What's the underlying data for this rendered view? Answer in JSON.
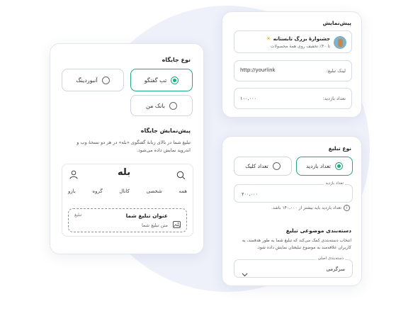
{
  "left": {
    "placement_title": "نوع جایگاه",
    "options": [
      "تب گفتگو",
      "آنبوردینگ",
      "بانک من"
    ],
    "preview_title": "پیش‌نمایش جایگاه",
    "preview_desc_1": "تبلیغ شما در بالای زبانهٔ گفتگوی «بله» در هر دو نسخهٔ وب و",
    "preview_desc_2": "اندروید نمایش داده می‌شود.",
    "app_logo": "بله",
    "tabs": [
      "همه",
      "شخصی",
      "کانال",
      "گروه",
      "بازو"
    ],
    "ad_title": "عنوان تبلیغ شما",
    "ad_text": "متن تبلیغ شما",
    "ad_badge": "تبلیغ"
  },
  "topright": {
    "title": "پیش‌نمایش",
    "ad_title": "جشنوارهٔ بزرگ تابستانه",
    "ad_sub": "تا ۴۰٪ تخفیف روی همهٔ محصولات",
    "link_label": "لینک تبلیغ:",
    "link_value": "http://yourlink",
    "views_label": "تعداد بازدید:",
    "views_value": "۱۰۰,۰۰۰"
  },
  "bottomright": {
    "type_title": "نوع تبلیغ",
    "type_options": [
      "تعداد بازدید",
      "تعداد کلیک"
    ],
    "views_field_label": "تعداد بازدید",
    "views_field_value": "۲۰۰,۰۰۰",
    "hint": "تعداد بازدید باید بیشتر از ۱۴۰,۰۰۰ باشد.",
    "cat_title": "دسته‌بندی موضوعی تبلیغ",
    "cat_desc_1": "انتخاب دسته‌بندی کمک می‌کند که تبلیغ شما به طور هدفمند، به",
    "cat_desc_2": "کاربران علاقه‌مند به موضوع تبلیغتان نمایش داده شود.",
    "cat_field_label": "دسته‌بندی اصلی",
    "cat_field_value": "سرگرمی"
  },
  "colors": {
    "accent": "#1fa883",
    "blob": "#eef1fa"
  },
  "icons": [
    "search-icon",
    "user-icon",
    "image-icon",
    "info-icon",
    "chevron-down-icon",
    "sun-icon"
  ]
}
